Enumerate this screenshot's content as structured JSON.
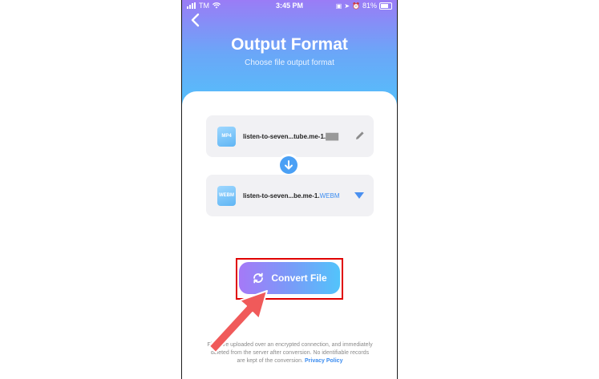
{
  "status_bar": {
    "carrier": "TM",
    "time": "3:45 PM",
    "battery": "81%"
  },
  "header": {
    "title": "Output Format",
    "subtitle": "Choose file output format"
  },
  "source_file": {
    "icon_label": "MP4",
    "name": "listen-to-seven...tube.me-1.",
    "extension": "███",
    "icon": "pencil-icon"
  },
  "target_file": {
    "icon_label": "WEBM",
    "name": "listen-to-seven...be.me-1.",
    "extension": "WEBM",
    "icon": "dropdown-triangle-icon"
  },
  "convert_button": {
    "label": "Convert File"
  },
  "footer": {
    "note": "Files are uploaded over an encrypted connection, and immediately deleted from the server after conversion. No identifiable records are kept of the conversion.",
    "link": "Privacy Policy"
  },
  "colors": {
    "accent": "#3b8cf0",
    "highlight_box": "#e00000",
    "annotation_arrow": "#f05a5a"
  }
}
